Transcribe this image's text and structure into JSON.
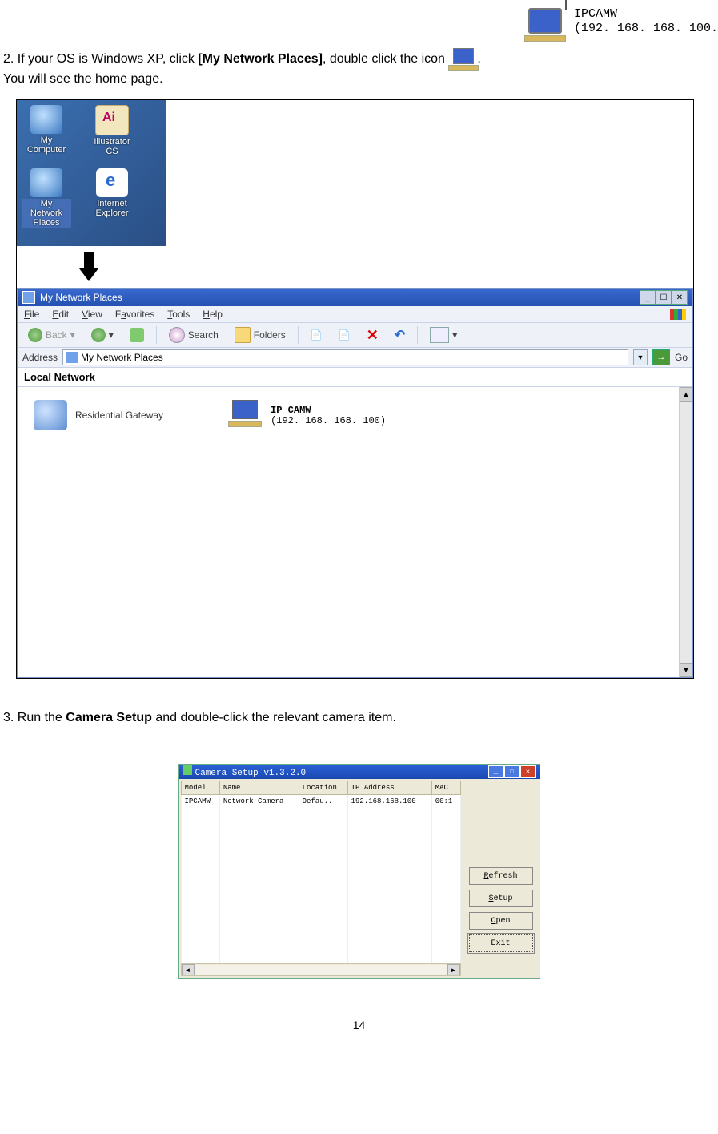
{
  "top_icon": {
    "title": "IPCAMW",
    "subtitle": "(192. 168. 168. 100."
  },
  "intro": {
    "line1a": "2. If your OS is Windows XP, click ",
    "bold": "[My Network Places]",
    "line1b": ", double click the icon ",
    "period": ".",
    "line2": "You will see the home page."
  },
  "desktop_icons": {
    "my_computer": "My Computer",
    "illustrator": "Illustrator CS",
    "my_network_places": "My Network Places",
    "internet_explorer": "Internet Explorer"
  },
  "xp_window": {
    "title": "My Network Places",
    "menus": {
      "file": "File",
      "edit": "Edit",
      "view": "View",
      "favorites": "Favorites",
      "tools": "Tools",
      "help": "Help"
    },
    "toolbar": {
      "back": "Back",
      "search": "Search",
      "folders": "Folders"
    },
    "address_label": "Address",
    "address_value": "My Network Places",
    "go_label": "Go",
    "section_header": "Local Network",
    "items": {
      "residential_gateway": "Residential Gateway",
      "ipcam_title": "IP CAMW",
      "ipcam_sub": "(192. 168. 168. 100)"
    }
  },
  "section3": {
    "prefix": "3. Run the ",
    "bold": "Camera Setup",
    "suffix": " and double-click the relevant camera item."
  },
  "camera_setup": {
    "title": "Camera Setup v1.3.2.0",
    "columns": {
      "model": "Model",
      "name": "Name",
      "location": "Location",
      "ip": "IP Address",
      "mac": "MAC"
    },
    "rows": [
      {
        "model": "IPCAMW",
        "name": "Network Camera",
        "location": "Defau..",
        "ip": "192.168.168.100",
        "mac": "00:1"
      }
    ],
    "empty_rows": 13,
    "buttons": {
      "refresh": "Refresh",
      "setup": "Setup",
      "open": "Open",
      "exit": "Exit"
    }
  },
  "page_number": "14"
}
